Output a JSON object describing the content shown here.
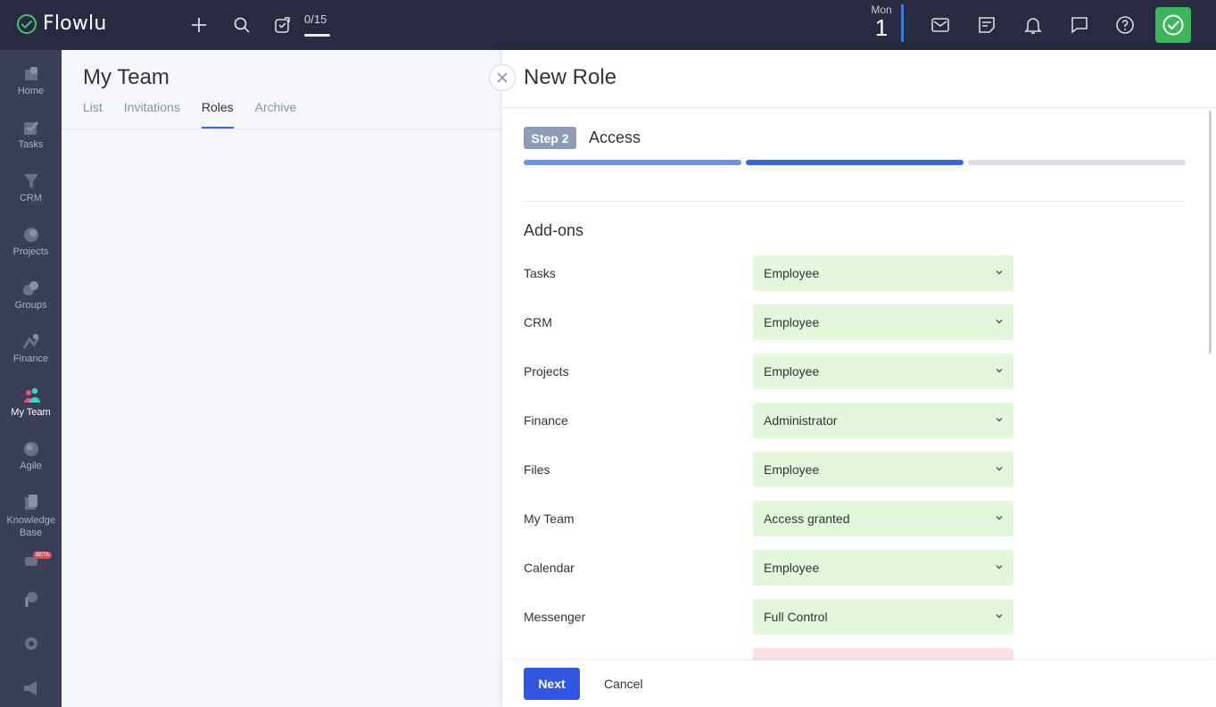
{
  "topbar": {
    "logo_text": "Flowlu",
    "counter": "0/15",
    "date_day": "Mon",
    "date_num": "1"
  },
  "sidebar": {
    "items": [
      {
        "label": "Home",
        "icon": "home-icon"
      },
      {
        "label": "Tasks",
        "icon": "tasks-icon"
      },
      {
        "label": "CRM",
        "icon": "crm-icon"
      },
      {
        "label": "Projects",
        "icon": "projects-icon"
      },
      {
        "label": "Groups",
        "icon": "groups-icon"
      },
      {
        "label": "Finance",
        "icon": "finance-icon"
      },
      {
        "label": "My Team",
        "icon": "my-team-icon"
      },
      {
        "label": "Agile",
        "icon": "agile-icon"
      },
      {
        "label": "Knowledge Base",
        "icon": "knowledge-base-icon"
      }
    ],
    "beta_badge": "BETA"
  },
  "main": {
    "title": "My Team",
    "tabs": [
      {
        "label": "List"
      },
      {
        "label": "Invitations"
      },
      {
        "label": "Roles"
      },
      {
        "label": "Archive"
      }
    ],
    "active_tab": "Roles"
  },
  "panel": {
    "title": "New Role",
    "step_badge": "Step 2",
    "step_title": "Access",
    "progress_colors": [
      "#6f8fe0",
      "#3a64d8",
      "#d9dde5"
    ],
    "section_title": "Add-ons",
    "rows": [
      {
        "label": "Tasks",
        "value": "Employee"
      },
      {
        "label": "CRM",
        "value": "Employee"
      },
      {
        "label": "Projects",
        "value": "Employee"
      },
      {
        "label": "Finance",
        "value": "Administrator"
      },
      {
        "label": "Files",
        "value": "Employee"
      },
      {
        "label": "My Team",
        "value": "Access granted"
      },
      {
        "label": "Calendar",
        "value": "Employee"
      },
      {
        "label": "Messenger",
        "value": "Full Control"
      }
    ],
    "next_label": "Next",
    "cancel_label": "Cancel"
  }
}
